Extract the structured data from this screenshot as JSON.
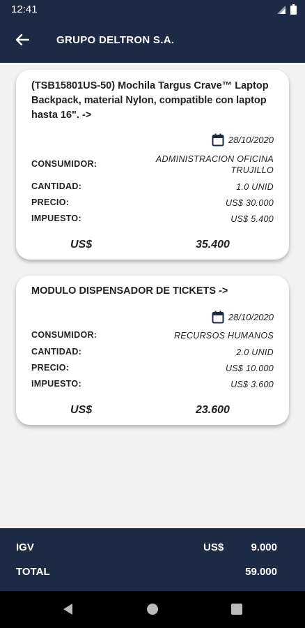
{
  "status": {
    "time": "12:41"
  },
  "header": {
    "title": "GRUPO DELTRON S.A."
  },
  "cards": [
    {
      "title": "(TSB15801US-50) Mochila Targus Crave™ Laptop Backpack, material Nylon, compatible con laptop hasta 16\". ->",
      "date": "28/10/2020",
      "consumidor_label": "CONSUMIDOR:",
      "consumidor_line1": "ADMINISTRACION OFICINA",
      "consumidor_line2": "TRUJILLO",
      "cantidad_label": "CANTIDAD:",
      "cantidad": "1.0 UNID",
      "precio_label": "PRECIO:",
      "precio": "US$ 30.000",
      "impuesto_label": "IMPUESTO:",
      "impuesto": "US$ 5.400",
      "total_currency": "US$",
      "total_value": "35.400"
    },
    {
      "title": "MODULO DISPENSADOR DE TICKETS ->",
      "date": "28/10/2020",
      "consumidor_label": "CONSUMIDOR:",
      "consumidor_line1": "RECURSOS HUMANOS",
      "cantidad_label": "CANTIDAD:",
      "cantidad": "2.0 UNID",
      "precio_label": "PRECIO:",
      "precio": "US$ 10.000",
      "impuesto_label": "IMPUESTO:",
      "impuesto": "US$ 3.600",
      "total_currency": "US$",
      "total_value": "23.600"
    }
  ],
  "footer": {
    "igv_label": "IGV",
    "igv_currency": "US$",
    "igv_value": "9.000",
    "total_label": "TOTAL",
    "total_value": "59.000"
  },
  "icons": {
    "back": "arrow-left-icon",
    "calendar": "calendar-icon",
    "signal": "signal-icon",
    "battery": "battery-icon",
    "nav_back": "triangle-back-icon",
    "nav_home": "circle-home-icon",
    "nav_recents": "square-recents-icon"
  },
  "colors": {
    "primary": "#1c2a44",
    "background": "#f2f2f2",
    "card": "#ffffff",
    "nav": "#000000"
  }
}
